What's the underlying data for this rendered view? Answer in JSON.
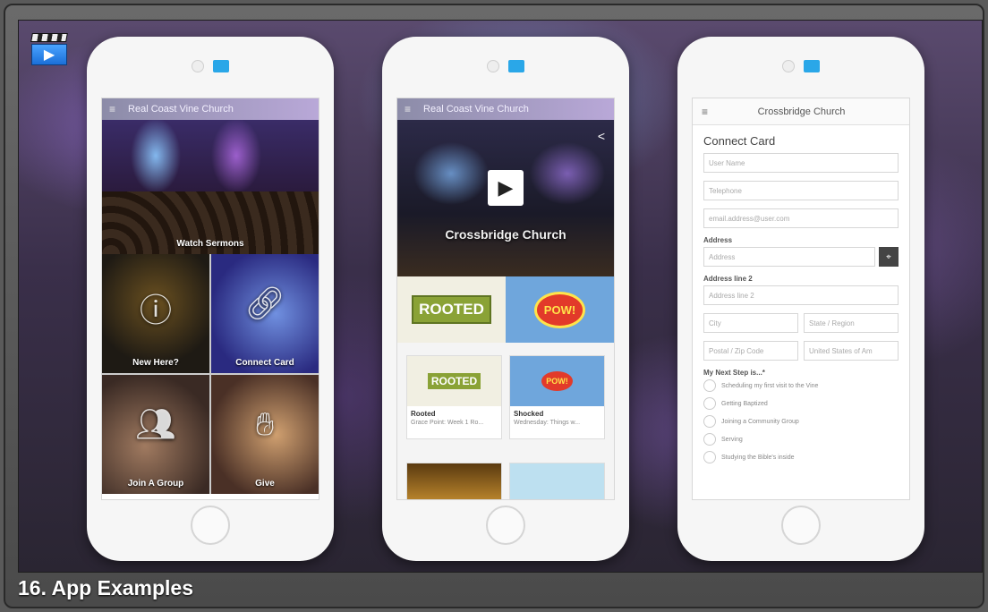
{
  "slide": {
    "caption": "16. App Examples",
    "icon": "video-clapper-icon"
  },
  "phone1": {
    "header_title": "Real Coast Vine Church",
    "hero_caption": "Watch Sermons",
    "tiles": [
      {
        "label": "New Here?",
        "icon": "info-icon"
      },
      {
        "label": "Connect Card",
        "icon": "link-icon"
      },
      {
        "label": "Join A Group",
        "icon": "group-icon"
      },
      {
        "label": "Give",
        "icon": "give-icon"
      }
    ]
  },
  "phone2": {
    "header_title": "Real Coast Vine Church",
    "hero_title": "Crossbridge Church",
    "banner_left": "ROOTED",
    "banner_right": "POW!",
    "cards": [
      {
        "thumb": "ROOTED",
        "title": "Rooted",
        "subtitle": "Grace Point: Week 1 Ro..."
      },
      {
        "thumb": "POW!",
        "title": "Shocked",
        "subtitle": "Wednesday: Things w..."
      }
    ]
  },
  "phone3": {
    "header_title": "Crossbridge Church",
    "form_title": "Connect Card",
    "fields": {
      "name": "User Name",
      "phone": "Telephone",
      "email": "email.address@user.com",
      "address_label": "Address",
      "address": "Address",
      "address2_label": "Address line 2",
      "address2": "Address line 2",
      "city": "City",
      "state": "State / Region",
      "zip": "Postal / Zip Code",
      "country": "United States of Am"
    },
    "next_step_label": "My Next Step is...*",
    "options": [
      "Scheduling my first visit to the Vine",
      "Getting Baptized",
      "Joining a Community Group",
      "Serving",
      "Studying the Bible's inside"
    ]
  }
}
